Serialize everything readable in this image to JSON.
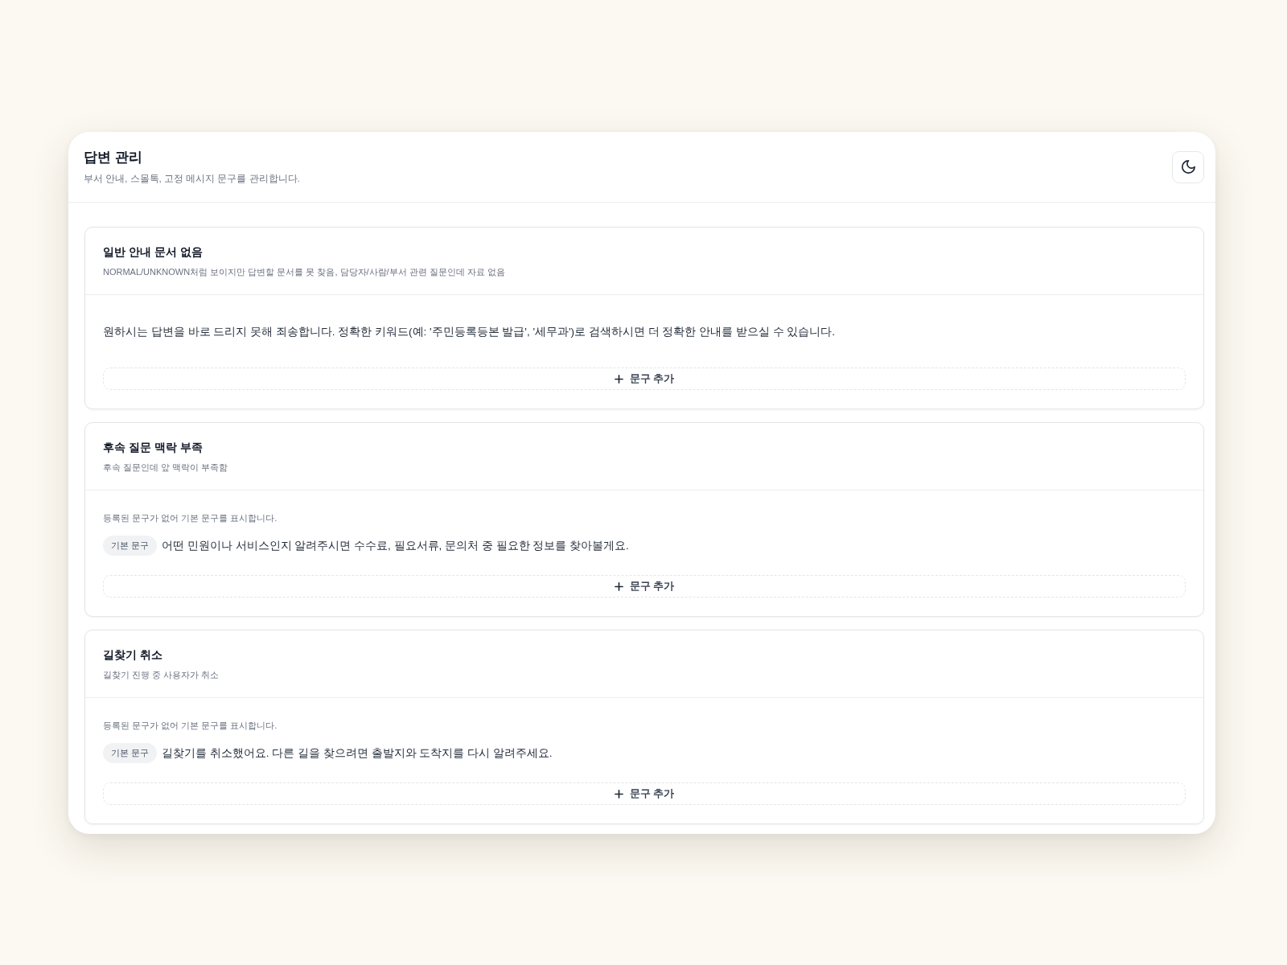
{
  "header": {
    "title": "답변 관리",
    "subtitle": "부서 안내, 스몰톡, 고정 메시지 문구를 관리합니다."
  },
  "sections": [
    {
      "title": "일반 안내 문서 없음",
      "description": "NORMAL/UNKNOWN처럼 보이지만 답변할 문서를 못 찾음, 담당자/사람/부서 관련 질문인데 자료 없음",
      "messages": [
        {
          "kind": "custom",
          "text": "원하시는 답변을 바로 드리지 못해 죄송합니다. 정확한 키워드(예: '주민등록등본 발급', '세무과')로 검색하시면 더 정확한 안내를 받으실 수 있습니다."
        }
      ],
      "add_button": "문구 추가"
    },
    {
      "title": "후속 질문 맥락 부족",
      "description": "후속 질문인데 앞 맥락이 부족함",
      "notice": "등록된 문구가 없어 기본 문구를 표시합니다.",
      "messages": [
        {
          "kind": "default",
          "tag": "기본 문구",
          "text": "어떤 민원이나 서비스인지 알려주시면 수수료, 필요서류, 문의처 중 필요한 정보를 찾아볼게요."
        }
      ],
      "add_button": "문구 추가"
    },
    {
      "title": "길찾기 취소",
      "description": "길찾기 진행 중 사용자가 취소",
      "notice": "등록된 문구가 없어 기본 문구를 표시합니다.",
      "messages": [
        {
          "kind": "default",
          "tag": "기본 문구",
          "text": "길찾기를 취소했어요. 다른 길을 찾으려면 출발지와 도착지를 다시 알려주세요."
        }
      ],
      "add_button": "문구 추가"
    }
  ]
}
